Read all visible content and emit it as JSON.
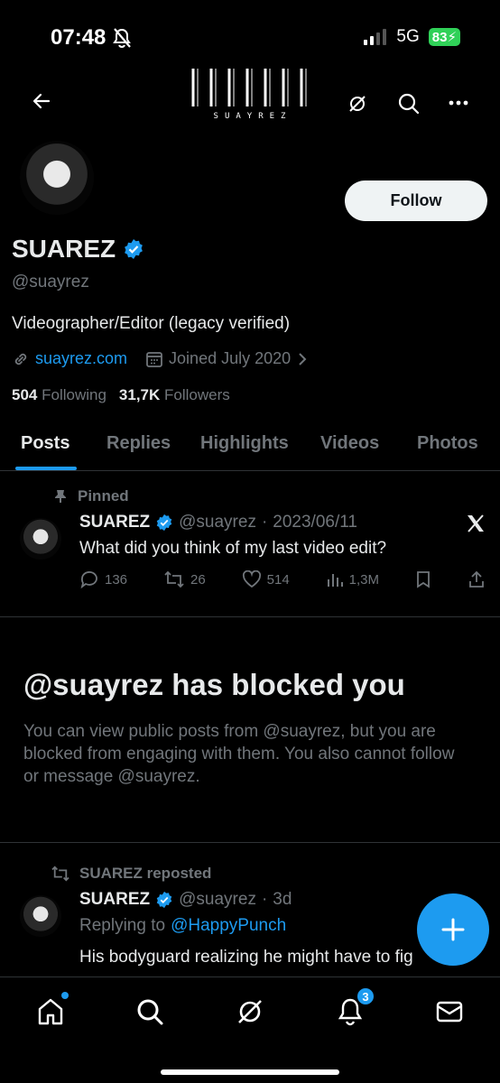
{
  "status_bar": {
    "time": "07:48",
    "network": "5G",
    "battery": "83"
  },
  "header": {
    "logo_text": "SUAYREZ"
  },
  "profile": {
    "name": "SUAREZ",
    "handle": "@suayrez",
    "bio": "Videographer/Editor (legacy verified)",
    "website": "suayrez.com",
    "joined": "Joined July 2020",
    "following_count": "504",
    "following_label": "Following",
    "followers_count": "31,7K",
    "followers_label": "Followers",
    "follow_button": "Follow"
  },
  "tabs": [
    "Posts",
    "Replies",
    "Highlights",
    "Videos",
    "Photos"
  ],
  "pinned_post": {
    "pinned_label": "Pinned",
    "name": "SUAREZ",
    "handle": "@suayrez",
    "separator": "·",
    "date": "2023/06/11",
    "text": "What did you think of my last video edit?",
    "replies": "136",
    "reposts": "26",
    "likes": "514",
    "views": "1,3M"
  },
  "blocked": {
    "title": "@suayrez has blocked you",
    "description": "You can view public posts from @suayrez, but you are blocked from engaging with them. You also cannot follow or message @suayrez."
  },
  "repost": {
    "reposted_label": "SUAREZ reposted",
    "name": "SUAREZ",
    "handle": "@suayrez",
    "separator": "·",
    "date": "3d",
    "replying_prefix": "Replying to",
    "replying_to": "@HappyPunch",
    "text": "His bodyguard realizing he might have to fig"
  },
  "notifications_badge": "3",
  "colors": {
    "accent": "#1d9bf0",
    "background": "#000000",
    "muted": "#71767b",
    "battery": "#30d158"
  }
}
